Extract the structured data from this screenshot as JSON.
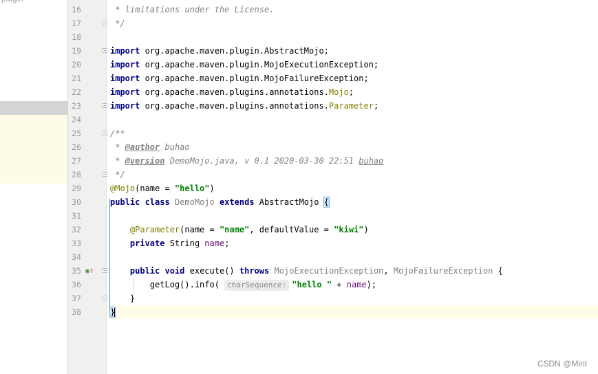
{
  "side_panel": {
    "partial_label": "plugin"
  },
  "watermark": "CSDN @Mint",
  "lines": [
    {
      "num": "16",
      "fold": false,
      "tokens": [
        {
          "t": " * limitations under the License.",
          "c": "cm"
        }
      ]
    },
    {
      "num": "17",
      "fold": true,
      "tokens": [
        {
          "t": " */",
          "c": "cm"
        }
      ]
    },
    {
      "num": "18",
      "fold": false,
      "tokens": []
    },
    {
      "num": "19",
      "fold": true,
      "tokens": [
        {
          "t": "import",
          "c": "kw"
        },
        {
          "t": " org.apache.maven.plugin.AbstractMojo;",
          "c": ""
        }
      ]
    },
    {
      "num": "20",
      "fold": false,
      "tokens": [
        {
          "t": "import",
          "c": "kw"
        },
        {
          "t": " org.apache.maven.plugin.MojoExecutionException;",
          "c": ""
        }
      ]
    },
    {
      "num": "21",
      "fold": false,
      "tokens": [
        {
          "t": "import",
          "c": "kw"
        },
        {
          "t": " org.apache.maven.plugin.MojoFailureException;",
          "c": ""
        }
      ]
    },
    {
      "num": "22",
      "fold": false,
      "tokens": [
        {
          "t": "import",
          "c": "kw"
        },
        {
          "t": " org.apache.maven.plugins.annotations.",
          "c": ""
        },
        {
          "t": "Mojo",
          "c": "ann"
        },
        {
          "t": ";",
          "c": ""
        }
      ]
    },
    {
      "num": "23",
      "fold": true,
      "tokens": [
        {
          "t": "import",
          "c": "kw"
        },
        {
          "t": " org.apache.maven.plugins.annotations.",
          "c": ""
        },
        {
          "t": "Parameter",
          "c": "ann"
        },
        {
          "t": ";",
          "c": ""
        }
      ]
    },
    {
      "num": "24",
      "fold": false,
      "tokens": []
    },
    {
      "num": "25",
      "fold": true,
      "tokens": [
        {
          "t": "/**",
          "c": "cm"
        }
      ]
    },
    {
      "num": "26",
      "fold": false,
      "tokens": [
        {
          "t": " * ",
          "c": "cm"
        },
        {
          "t": "@author",
          "c": "tag"
        },
        {
          "t": " buhao",
          "c": "cm"
        }
      ]
    },
    {
      "num": "27",
      "fold": false,
      "tokens": [
        {
          "t": " * ",
          "c": "cm"
        },
        {
          "t": "@version",
          "c": "tag"
        },
        {
          "t": " ",
          "c": "cm"
        },
        {
          "t": "DemoMojo.java, v 0.1 2020-03-30 22:51",
          "c": "cm"
        },
        {
          "t": " ",
          "c": "cm"
        },
        {
          "t": "buhao",
          "c": "tagval"
        }
      ]
    },
    {
      "num": "28",
      "fold": true,
      "tokens": [
        {
          "t": " */",
          "c": "cm"
        }
      ]
    },
    {
      "num": "29",
      "fold": false,
      "tokens": [
        {
          "t": "@Mojo",
          "c": "ann"
        },
        {
          "t": "(name = ",
          "c": ""
        },
        {
          "t": "\"hello\"",
          "c": "str"
        },
        {
          "t": ")",
          "c": ""
        }
      ]
    },
    {
      "num": "30",
      "fold": false,
      "tokens": [
        {
          "t": "public class",
          "c": "kw"
        },
        {
          "t": " ",
          "c": ""
        },
        {
          "t": "DemoMojo",
          "c": "unused"
        },
        {
          "t": " ",
          "c": ""
        },
        {
          "t": "extends",
          "c": "kw"
        },
        {
          "t": " AbstractMojo ",
          "c": ""
        },
        {
          "t": "{",
          "c": "brace"
        }
      ]
    },
    {
      "num": "31",
      "fold": false,
      "tokens": []
    },
    {
      "num": "32",
      "fold": false,
      "tokens": [
        {
          "t": "    ",
          "c": ""
        },
        {
          "t": "@Parameter",
          "c": "ann"
        },
        {
          "t": "(name = ",
          "c": ""
        },
        {
          "t": "\"name\"",
          "c": "str"
        },
        {
          "t": ", defaultValue = ",
          "c": ""
        },
        {
          "t": "\"kiwi\"",
          "c": "str"
        },
        {
          "t": ")",
          "c": ""
        }
      ]
    },
    {
      "num": "33",
      "fold": false,
      "tokens": [
        {
          "t": "    ",
          "c": ""
        },
        {
          "t": "private",
          "c": "kw"
        },
        {
          "t": " String ",
          "c": ""
        },
        {
          "t": "name",
          "c": "fld"
        },
        {
          "t": ";",
          "c": ""
        }
      ]
    },
    {
      "num": "34",
      "fold": false,
      "tokens": []
    },
    {
      "num": "35",
      "fold": true,
      "marker": true,
      "tokens": [
        {
          "t": "    ",
          "c": ""
        },
        {
          "t": "public void",
          "c": "kw"
        },
        {
          "t": " execute() ",
          "c": ""
        },
        {
          "t": "throws",
          "c": "kw"
        },
        {
          "t": " ",
          "c": ""
        },
        {
          "t": "MojoExecutionException",
          "c": "unused"
        },
        {
          "t": ", ",
          "c": ""
        },
        {
          "t": "MojoFailureException",
          "c": "unused"
        },
        {
          "t": " {",
          "c": ""
        }
      ]
    },
    {
      "num": "36",
      "fold": false,
      "tokens": [
        {
          "t": "        getLog().info( ",
          "c": ""
        },
        {
          "t": "charSequence:",
          "c": "hint"
        },
        {
          "t": "\"hello \"",
          "c": "str"
        },
        {
          "t": " + ",
          "c": ""
        },
        {
          "t": "name",
          "c": "fld"
        },
        {
          "t": ");",
          "c": ""
        }
      ]
    },
    {
      "num": "37",
      "fold": true,
      "tokens": [
        {
          "t": "    }",
          "c": ""
        }
      ]
    },
    {
      "num": "38",
      "fold": false,
      "current": true,
      "tokens": [
        {
          "t": "}",
          "c": "brace"
        }
      ]
    }
  ]
}
